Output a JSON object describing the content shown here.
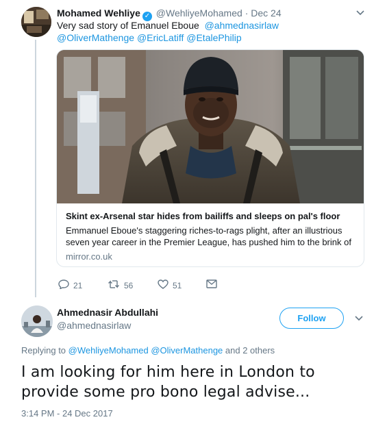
{
  "tweet": {
    "author_name": "Mohamed Wehliye",
    "verified_glyph": "✓",
    "handle": "@WehliyeMohamed",
    "separator": "·",
    "date": "Dec 24",
    "text": "Very sad story of Emanuel Eboue",
    "mentions": [
      "@ahmednasirlaw",
      "@OliverMathenge",
      "@EricLatiff",
      "@EtalePhilip"
    ],
    "card": {
      "title": "Skint ex-Arsenal star hides from bailiffs and sleeps on pal's floor",
      "description": "Emmanuel Eboue's staggering riches-to-rags plight, after an illustrious seven year career in the Premier League, has pushed him to the brink of",
      "domain": "mirror.co.uk"
    },
    "actions": {
      "replies": "21",
      "retweets": "56",
      "likes": "51"
    }
  },
  "reply": {
    "author_name": "Ahmednasir Abdullahi",
    "handle": "@ahmednasirlaw",
    "follow_label": "Follow",
    "replying_prefix": "Replying to",
    "replying_to": [
      "@WehliyeMohamed",
      "@OliverMathenge"
    ],
    "replying_suffix": "and 2 others",
    "text": "I am looking for him here in London to provide some pro bono legal advise...",
    "timestamp": "3:14 PM - 24 Dec 2017"
  },
  "icons": {
    "caret": "chevron-down-icon",
    "reply": "reply-icon",
    "retweet": "retweet-icon",
    "like": "heart-icon",
    "dm": "envelope-icon"
  },
  "colors": {
    "link": "#1b95e0",
    "follow": "#1da1f2",
    "muted": "#657786"
  }
}
